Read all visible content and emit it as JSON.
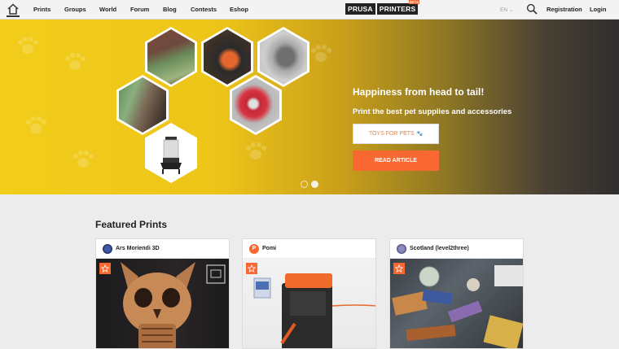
{
  "nav": {
    "links": [
      "Prints",
      "Groups",
      "World",
      "Forum",
      "Blog",
      "Contests",
      "Eshop"
    ],
    "logo_left": "PRUSA",
    "logo_right": "PRINTERS",
    "logo_badge": "BETA",
    "language": "EN",
    "registration": "Registration",
    "login": "Login"
  },
  "hero": {
    "title": "Happiness from head to tail!",
    "subtitle": "Print the best pet supplies and accessories",
    "secondary_button": "TOYS FOR PETS",
    "primary_button": "READ ARTICLE",
    "slides": 2,
    "active_slide": 2
  },
  "featured": {
    "title": "Featured Prints",
    "cards": [
      {
        "author": "Ars Moriendi 3D"
      },
      {
        "author": "Pomi",
        "avatar_letter": "P"
      },
      {
        "author": "Scotland (level2three)"
      }
    ]
  },
  "colors": {
    "accent": "#fa6831",
    "hero_yellow": "#f2cd1b",
    "hero_dark": "#2f2d2d"
  }
}
